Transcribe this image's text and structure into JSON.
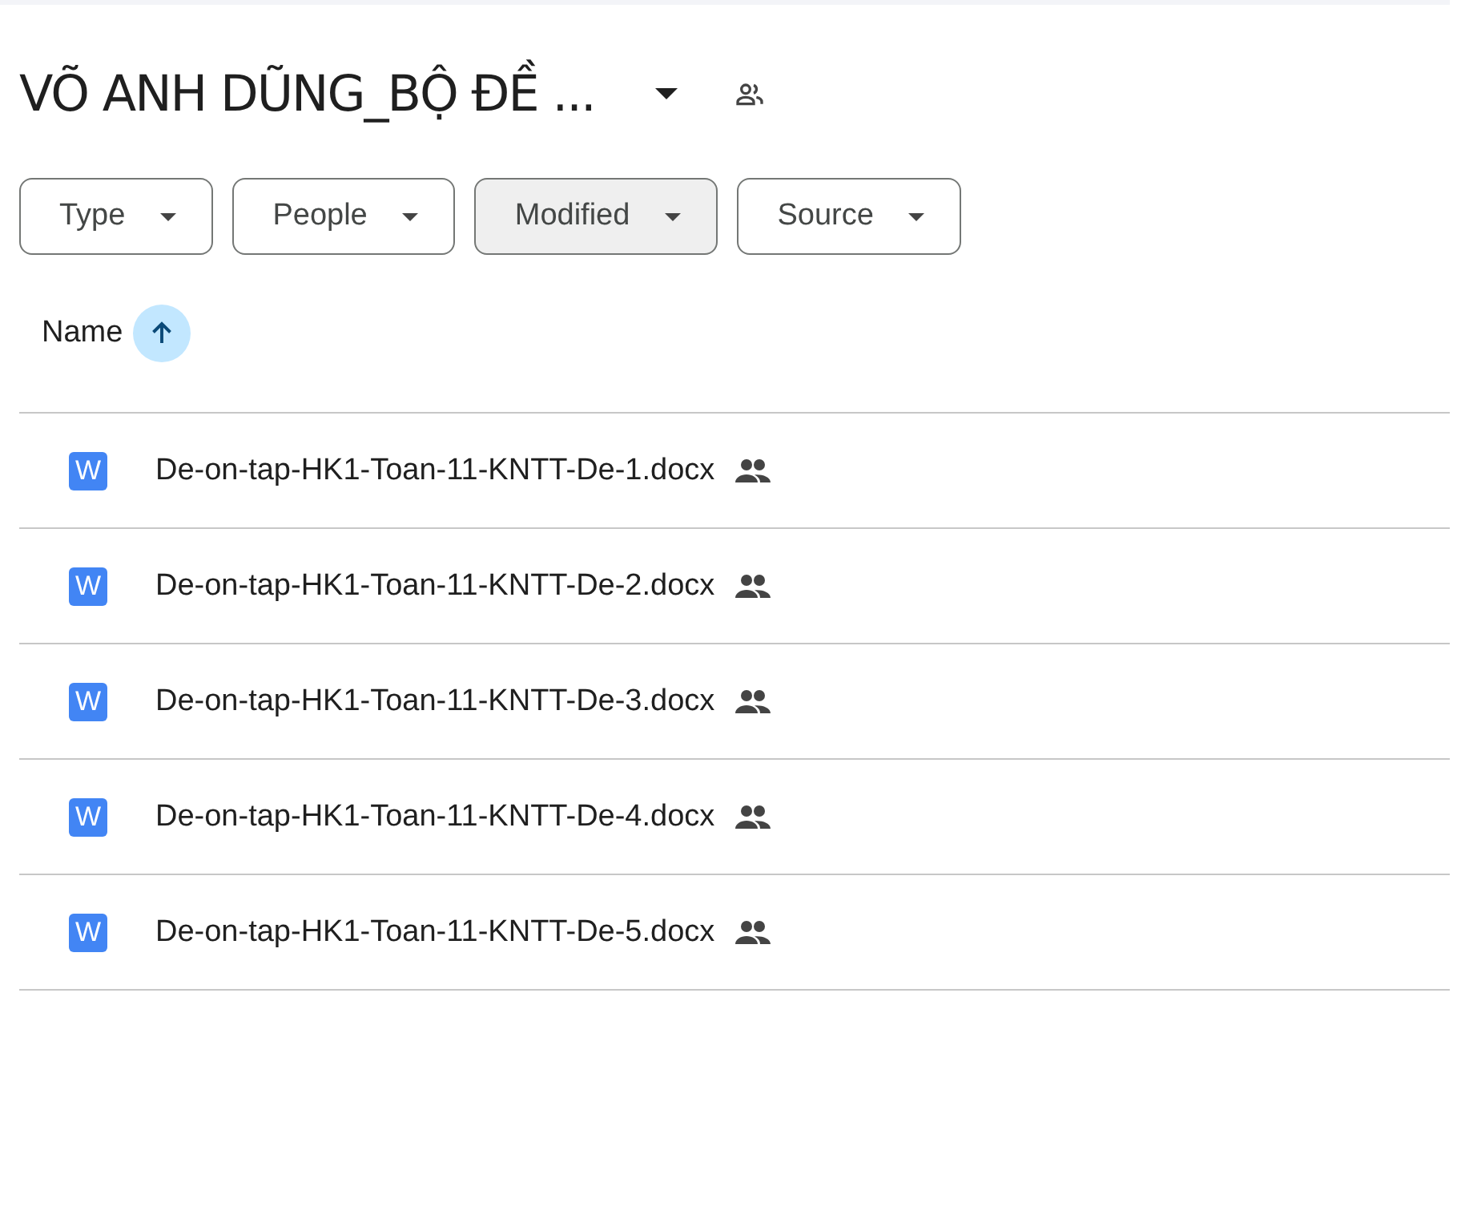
{
  "folder": {
    "title": "VÕ ANH DŨNG_BỘ ĐỀ ...",
    "shared": true
  },
  "filters": [
    {
      "label": "Type",
      "selected": false
    },
    {
      "label": "People",
      "selected": false
    },
    {
      "label": "Modified",
      "selected": true
    },
    {
      "label": "Source",
      "selected": false
    }
  ],
  "table": {
    "columns": [
      {
        "label": "Name",
        "sort_ascending": true
      }
    ],
    "rows": [
      {
        "icon_letter": "W",
        "name": "De-on-tap-HK1-Toan-11-KNTT-De-1.docx",
        "shared": true
      },
      {
        "icon_letter": "W",
        "name": "De-on-tap-HK1-Toan-11-KNTT-De-2.docx",
        "shared": true
      },
      {
        "icon_letter": "W",
        "name": "De-on-tap-HK1-Toan-11-KNTT-De-3.docx",
        "shared": true
      },
      {
        "icon_letter": "W",
        "name": "De-on-tap-HK1-Toan-11-KNTT-De-4.docx",
        "shared": true
      },
      {
        "icon_letter": "W",
        "name": "De-on-tap-HK1-Toan-11-KNTT-De-5.docx",
        "shared": true
      }
    ]
  }
}
